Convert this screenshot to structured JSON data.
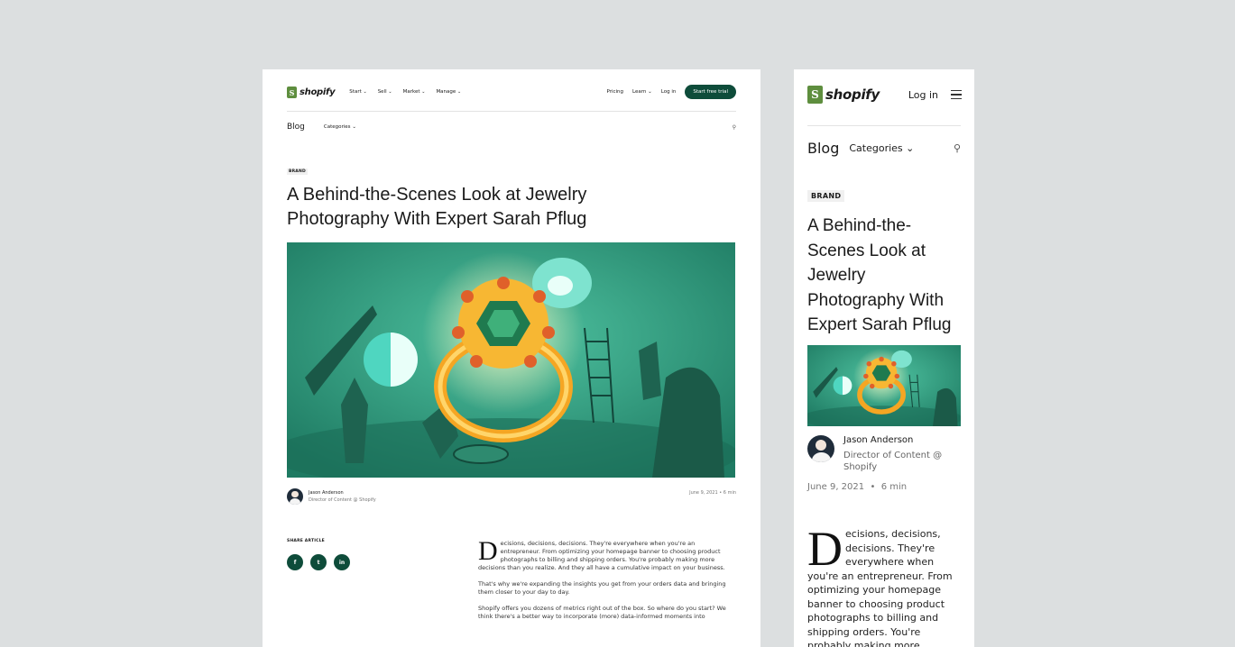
{
  "brand": {
    "name": "shopify",
    "color": "#5e8e3e",
    "accent": "#0e4c3a"
  },
  "desktop_nav": {
    "menu": [
      {
        "label": "Start",
        "icon": "chevron-down-icon"
      },
      {
        "label": "Sell",
        "icon": "chevron-down-icon"
      },
      {
        "label": "Market",
        "icon": "chevron-down-icon"
      },
      {
        "label": "Manage",
        "icon": "chevron-down-icon"
      }
    ],
    "pricing": "Pricing",
    "learn": "Learn",
    "login": "Log in",
    "cta": "Start free trial"
  },
  "blog_bar": {
    "blog": "Blog",
    "categories": "Categories",
    "search_icon": "search-icon"
  },
  "article": {
    "tag": "BRAND",
    "title": "A Behind-the-Scenes Look at Jewelry Photography With Expert Sarah Pflug",
    "author_name": "Jason Anderson",
    "author_role": "Director of Content @ Shopify",
    "date": "June 9, 2021",
    "separator": "•",
    "read_time": "6 min",
    "share_label": "SHARE ARTICLE",
    "share_buttons": [
      {
        "label": "f",
        "icon": "facebook-icon"
      },
      {
        "label": "t",
        "icon": "twitter-icon"
      },
      {
        "label": "in",
        "icon": "linkedin-icon"
      }
    ],
    "drop_cap": "D",
    "para1": "ecisions, decisions, decisions. They're everywhere when you're an entrepreneur. From optimizing your homepage banner to choosing product photographs to billing and shipping orders. You're probably making more decisions than you realize. And they all have a cumulative impact on your business.",
    "para2": "That's why we're expanding the insights you get from your orders data and bringing them closer to your day to day.",
    "para3": "Shopify offers you dozens of metrics right out of the box. So where do you start? We think there's a better way to incorporate (more) data-informed moments into",
    "mobile_para1": "ecisions, decisions, decisions. They're everywhere when you're an entrepreneur. From optimizing your homepage banner to choosing product photographs to billing and shipping orders. You're probably making more decisions than you"
  },
  "mobile_nav": {
    "login": "Log in",
    "menu_icon": "hamburger-icon"
  },
  "hero_image": {
    "icon": "jewelry-illustration",
    "colors": {
      "bg": "#2f9a7e",
      "ring": "#f5a623",
      "gem": "#1f7a4f"
    }
  }
}
